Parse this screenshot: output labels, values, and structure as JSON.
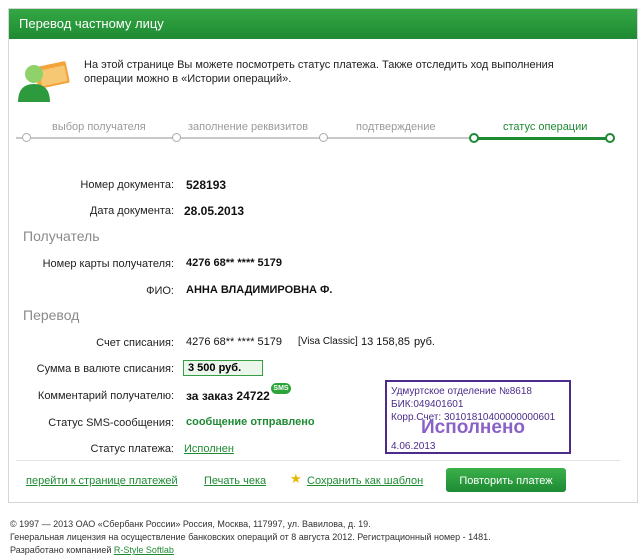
{
  "header": {
    "title": "Перевод частному лицу"
  },
  "intro": {
    "text": "На этой странице Вы можете посмотреть статус платежа. Также отследить ход выполнения операции можно в «Истории операций»."
  },
  "steps": [
    "выбор получателя",
    "заполнение реквизитов",
    "подтверждение",
    "статус операции"
  ],
  "document": {
    "number_label": "Номер документа:",
    "number": "528193",
    "date_label": "Дата документа:",
    "date": "28.05.2013"
  },
  "recipient": {
    "section": "Получатель",
    "card_label": "Номер карты получателя:",
    "card": "4276 68** **** 5179",
    "name_label": "ФИО:",
    "name": "АННА ВЛАДИМИРОВНА Ф."
  },
  "transfer": {
    "section": "Перевод",
    "account_label": "Счет списания:",
    "account_number": "4276 68** **** 5179",
    "account_type": "[Visa Classic]",
    "account_balance": "13 158,85",
    "account_currency": "руб.",
    "amount_label": "Сумма в валюте списания:",
    "amount": "3 500  руб.",
    "comment_label": "Комментарий получателю:",
    "comment": "за заказ 24722",
    "sms_badge": "SMS",
    "sms_label": "Статус SMS-сообщения:",
    "sms_status": "сообщение отправлено",
    "status_label": "Статус платежа:",
    "status": "Исполнен"
  },
  "stamp": {
    "line1": "Удмуртское отделение №8618",
    "line2": "БИК:049401601",
    "line3": "Корр.Счет: 30101810400000000601",
    "big": "Исполнено",
    "date": "4.06.2013"
  },
  "actions": {
    "back": "перейти к странице платежей",
    "print": "Печать чека",
    "save_template": "Сохранить как шаблон",
    "repeat": "Повторить платеж"
  },
  "footer": {
    "line1": "© 1997 — 2013 ОАО «Сбербанк России» Россия, Москва, 117997, ул. Вавилова, д. 19.",
    "line2": "Генеральная лицензия на осуществление банковских операций от 8 августа 2012. Регистрационный номер - 1481.",
    "line3_prefix": "Разработано компанией",
    "line3_link": "R-Style Softlab"
  },
  "colors": {
    "accent": "#1e8a33",
    "stamp": "#4b2c8a"
  }
}
